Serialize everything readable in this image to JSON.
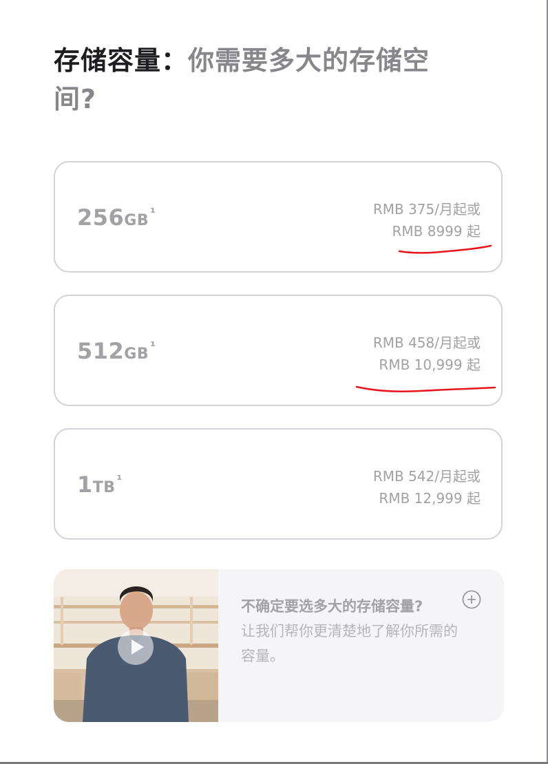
{
  "heading": {
    "strong": "存储容量：",
    "muted": "你需要多大的存储空间?"
  },
  "options": [
    {
      "size": "256",
      "unit": "GB",
      "note": "¹",
      "monthly": "RMB 375/月起或",
      "total": "RMB 8999 起"
    },
    {
      "size": "512",
      "unit": "GB",
      "note": "¹",
      "monthly": "RMB 458/月起或",
      "total": "RMB 10,999 起"
    },
    {
      "size": "1",
      "unit": "TB",
      "note": "¹",
      "monthly": "RMB 542/月起或",
      "total": "RMB 12,999 起"
    }
  ],
  "help": {
    "title": "不确定要选多大的存储容量?",
    "desc": "让我们帮你更清楚地了解你所需的容量。",
    "expand_icon": "plus-circle-icon",
    "play_icon": "play-icon"
  },
  "colors": {
    "annotation": "#e8141c",
    "card_border": "#d2d2d7",
    "muted_text": "#a1a1a6",
    "heading_dark": "#1d1d1f",
    "heading_muted": "#86868b"
  }
}
